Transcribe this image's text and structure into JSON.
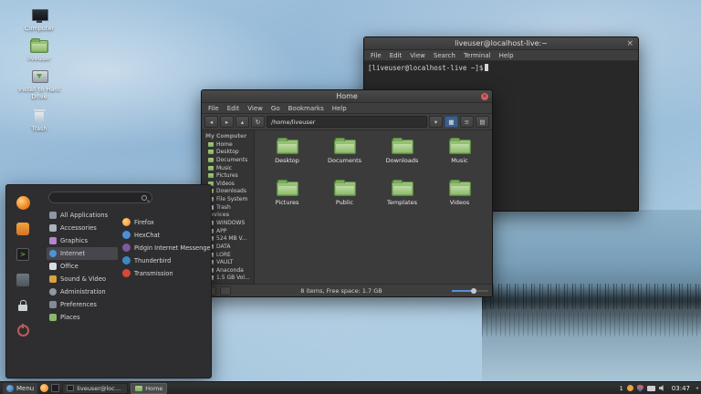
{
  "colors": {
    "accent_blue": "#5b8fd4",
    "folder_green": "#8bb96b",
    "firefox_orange": "#f08a2c",
    "close_red": "#d35f5f",
    "panel_dark": "#2a2a2a"
  },
  "glyphs": {
    "close": "×",
    "back": "◂",
    "forward": "▸",
    "up": "▴",
    "refresh": "↻",
    "dropdown": "▾",
    "view_grid": "▦",
    "view_list": "≡",
    "view_compact": "▤",
    "terminal_prompt_icon": ">",
    "tray_arrow": "◂"
  },
  "desktop_icons": [
    {
      "label": "Computer"
    },
    {
      "label": "liveuser"
    },
    {
      "label": "Install to Hard Drive"
    },
    {
      "label": "Trash"
    }
  ],
  "terminal_window": {
    "title": "liveuser@localhost-live:~",
    "menu": [
      "File",
      "Edit",
      "View",
      "Search",
      "Terminal",
      "Help"
    ],
    "prompt": "[liveuser@localhost-live ~]$"
  },
  "file_manager": {
    "title": "Home",
    "menu": [
      "File",
      "Edit",
      "View",
      "Go",
      "Bookmarks",
      "Help"
    ],
    "path_value": "/home/liveuser",
    "sidebar": {
      "computer_header": "My Computer",
      "places": [
        "Home",
        "Desktop",
        "Documents",
        "Music",
        "Pictures",
        "Videos",
        "Downloads",
        "File System",
        "Trash"
      ],
      "devices_header": "Devices",
      "devices": [
        "WINDOWS",
        "APP",
        "524 MB V...",
        "DATA",
        "LORE",
        "VAULT",
        "Anaconda",
        "1.5 GB Vol..."
      ]
    },
    "folders": [
      "Desktop",
      "Documents",
      "Downloads",
      "Music",
      "Pictures",
      "Public",
      "Templates",
      "Videos"
    ],
    "status_text": "8 items, Free space: 1.7 GB"
  },
  "app_menu": {
    "search": {
      "value": "",
      "placeholder": ""
    },
    "favorite_icons": [
      "firefox-icon",
      "software-icon",
      "terminal-icon",
      "files-icon",
      "lock-screen-icon",
      "shutdown-icon"
    ],
    "categories": [
      "All Applications",
      "Accessories",
      "Graphics",
      "Internet",
      "Office",
      "Sound & Video",
      "Administration",
      "Preferences",
      "Places"
    ],
    "active_category": "Internet",
    "apps": [
      "Firefox",
      "HexChat",
      "Pidgin Internet Messenger",
      "Thunderbird",
      "Transmission"
    ]
  },
  "taskbar": {
    "menu_label": "Menu",
    "tasks": [
      {
        "label": "liveuser@localh...",
        "active": false
      },
      {
        "label": "Home",
        "active": true
      }
    ],
    "notification_count": "1",
    "clock": "03:47"
  }
}
